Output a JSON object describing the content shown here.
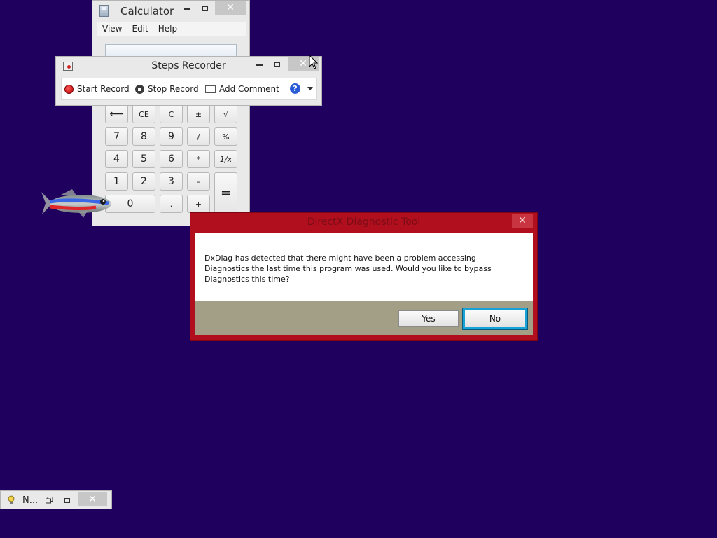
{
  "desktop": {
    "background": "#20005e"
  },
  "calculator": {
    "title": "Calculator",
    "close_glyph": "✕",
    "menu": [
      "View",
      "Edit",
      "Help"
    ],
    "display_value": "",
    "keys": {
      "backspace": "⟵",
      "ce": "CE",
      "c": "C",
      "plus_minus": "±",
      "sqrt": "√",
      "seven": "7",
      "eight": "8",
      "nine": "9",
      "divide": "/",
      "percent": "%",
      "four": "4",
      "five": "5",
      "six": "6",
      "multiply": "*",
      "reciprocal": "1/x",
      "one": "1",
      "two": "2",
      "three": "3",
      "minus": "-",
      "equals": "=",
      "zero": "0",
      "decimal": ".",
      "plus": "+"
    }
  },
  "steps_recorder": {
    "title": "Steps Recorder",
    "close_glyph": "✕",
    "start_record": "Start Record",
    "stop_record": "Stop Record",
    "add_comment": "Add Comment",
    "help_glyph": "?"
  },
  "dialog": {
    "title": "DirectX Diagnostic Tool",
    "close_glyph": "✕",
    "message": "DxDiag has detected that there might have been a problem accessing Diagnostics the last time this program was used.  Would you like to bypass Diagnostics this time?",
    "yes_label": "Yes",
    "no_label": "No",
    "accent_color": "#b10e1e"
  },
  "minimized_window": {
    "label": "N...",
    "close_glyph": "✕"
  }
}
